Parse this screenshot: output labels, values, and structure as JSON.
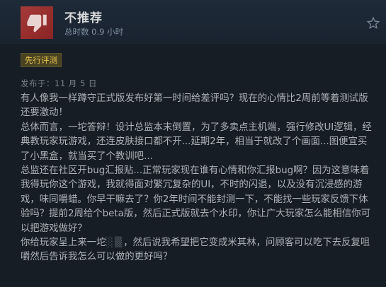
{
  "review": {
    "verdict": "不推荐",
    "hours": "总时数 0.9 小时",
    "badge": "先行评测",
    "posted": "发布于：11 月 5 日",
    "paragraphs": [
      "有人像我一样蹲守正式版发布好第一时间给差评吗？现在的心情比2周前等着测试版还要激动！",
      "总体而言，一坨答辩！设计总监本末倒置，为了多卖点主机端，强行修改UI逻辑，经典教玩家玩游戏，还连皮肤接口都不开...延期2年，相当于就改了个画面...图便宜买了小黑盒，就当买了个教训吧...",
      "总监还在社区开bug汇报贴...正常玩家现在谁有心情和你汇报bug啊？因为这意味着我得玩你这个游戏，我就得面对繁冗复杂的UI，不时的闪退，以及没有沉浸感的游戏，味同嚼蜡。你早干嘛去了？你2年时间不能封测一下，不能找一些玩家反馈下体验吗？提前2周给个beta版，然后正式版就去个水印，你让广大玩家怎么能相信你可以把游戏做好？",
      "你给玩家呈上来一坨",
      "，然后说我希望把它变成米其林，问顾客可以吃下去反复咀嚼然后告诉我怎么可以做的更好吗？"
    ]
  },
  "icons": {
    "thumb": "thumbs-down-icon",
    "award": "award-icon"
  },
  "colors": {
    "thumb_bg": "#a53a3a",
    "badge_text": "#e8c44f",
    "badge_bg": "#4a4321"
  }
}
